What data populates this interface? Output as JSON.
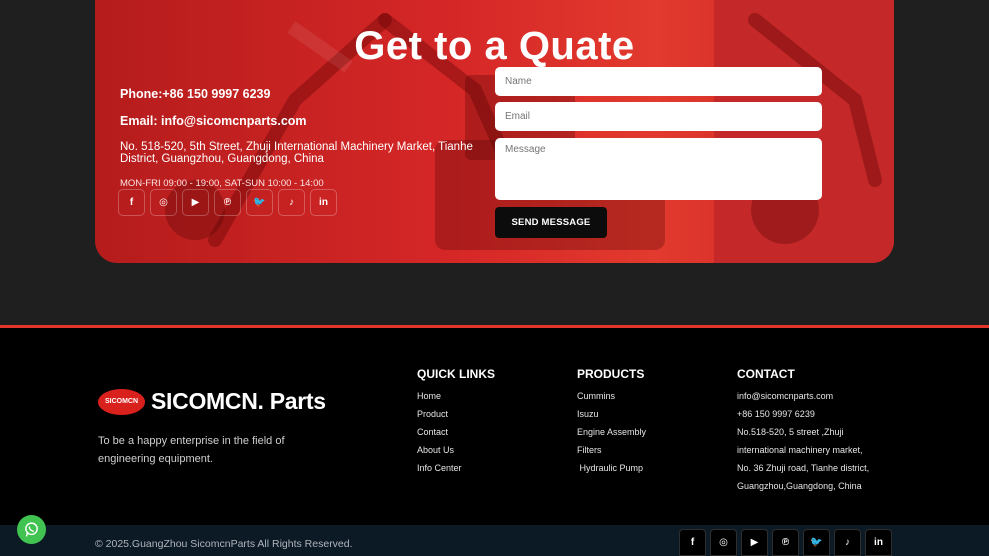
{
  "quote": {
    "title": "Get to a Quate",
    "phone": "Phone:+86 150 9997 6239",
    "email": "Email: info@sicomcnparts.com",
    "address": "No. 518-520, 5th Street, Zhuji International Machinery Market, Tianhe District, Guangzhou, Guangdong, China",
    "hours": "MON-FRI 09:00 - 19:00, SAT-SUN 10:00 - 14:00",
    "form": {
      "name_placeholder": "Name",
      "email_placeholder": "Email",
      "message_placeholder": "Message",
      "send_label": "SEND MESSAGE"
    }
  },
  "social": [
    {
      "icon": "facebook-icon",
      "glyph": "f"
    },
    {
      "icon": "instagram-icon",
      "glyph": "◎"
    },
    {
      "icon": "youtube-icon",
      "glyph": "▶"
    },
    {
      "icon": "pinterest-icon",
      "glyph": "℗"
    },
    {
      "icon": "twitter-icon",
      "glyph": "🐦"
    },
    {
      "icon": "tiktok-icon",
      "glyph": "♪"
    },
    {
      "icon": "linkedin-icon",
      "glyph": "in"
    }
  ],
  "footer": {
    "logo_badge": "SICOMCN",
    "logo_text": "SICOMCN. Parts",
    "tagline": "To be a happy enterprise in the field of engineering equipment.",
    "quick_links": {
      "title": "QUICK LINKS",
      "items": [
        "Home",
        "Product",
        "Contact",
        "About Us",
        "Info Center"
      ]
    },
    "products": {
      "title": "PRODUCTS",
      "items": [
        "Cummins",
        "Isuzu",
        "Engine Assembly",
        "Filters",
        " Hydraulic Pump"
      ]
    },
    "contact": {
      "title": "CONTACT",
      "items": [
        "info@sicomcnparts.com",
        "+86 150 9997 6239",
        "No.518-520, 5 street ,Zhuji",
        "international machinery market,",
        "No. 36 Zhuji road, Tianhe district,",
        "Guangzhou,Guangdong, China"
      ]
    },
    "copyright": "© 2025.GuangZhou SicomcnParts All Rights Reserved."
  },
  "colors": {
    "brand_red": "#e2352b",
    "whatsapp_green": "#40c351"
  }
}
